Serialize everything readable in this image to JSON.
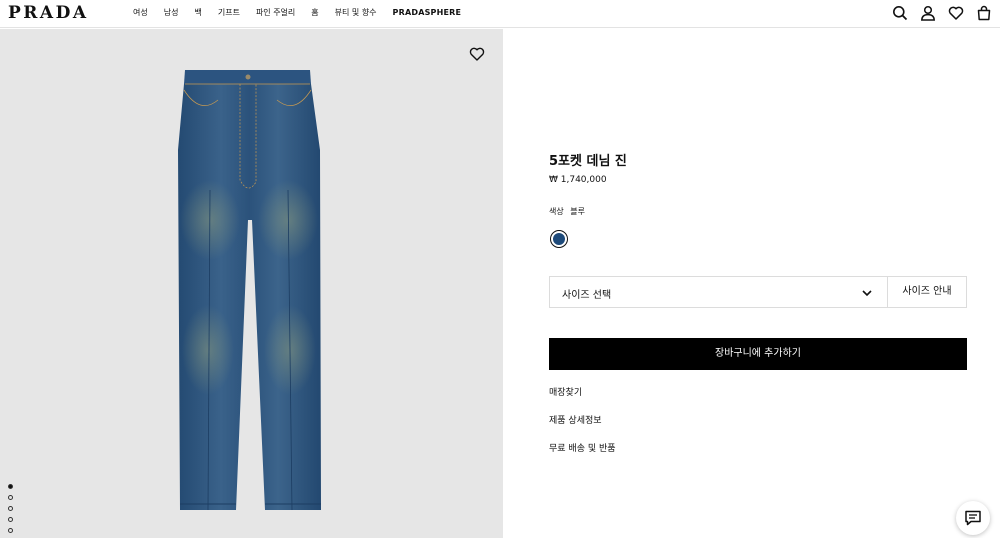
{
  "header": {
    "logo": "PRADA",
    "nav": [
      "여성",
      "남성",
      "백",
      "기프트",
      "파인 주얼리",
      "홈",
      "뷰티 및 향수",
      "PRADASPHERE"
    ],
    "icons": [
      "search-icon",
      "account-icon",
      "wishlist-icon",
      "bag-icon"
    ]
  },
  "product": {
    "title": "5포켓 데님 진",
    "price": "₩ 1,740,000",
    "color_label": "색상",
    "color_value": "블루",
    "swatch_color": "#1e4a7a",
    "size_select_label": "사이즈 선택",
    "size_guide_label": "사이즈 안내",
    "add_to_cart_label": "장바구니에 추가하기",
    "links": [
      "매장찾기",
      "제품 상세정보",
      "무료 배송 및 반품"
    ]
  },
  "gallery": {
    "image_count": 5,
    "active_index": 0
  },
  "colors": {
    "brand": "#000000",
    "image_bg": "#e6e6e6",
    "denim": "#2d5279"
  }
}
